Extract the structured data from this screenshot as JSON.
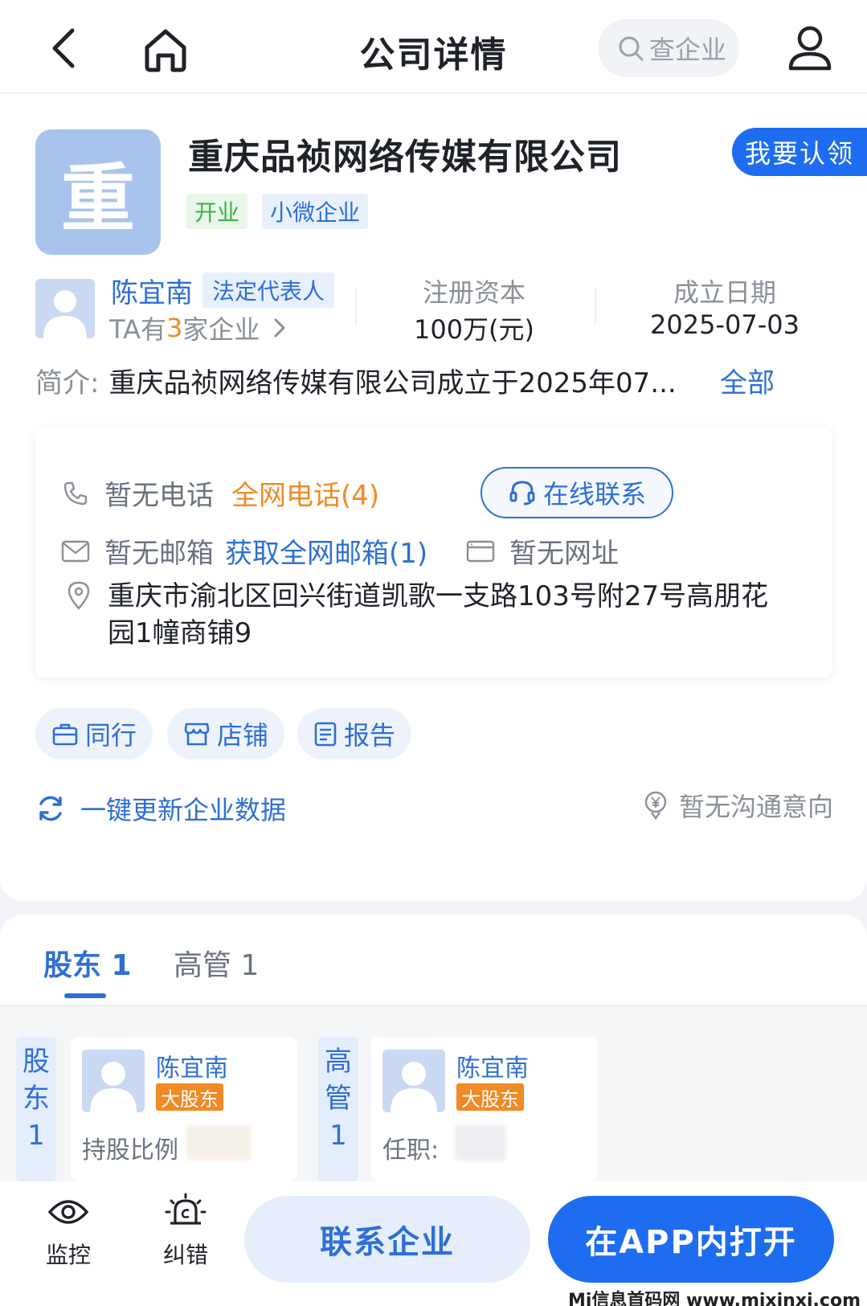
{
  "header": {
    "title": "公司详情",
    "search_label": "查企业"
  },
  "company": {
    "logo_char": "重",
    "name": "重庆品祯网络传媒有限公司",
    "claim_label": "我要认领",
    "tags": [
      "开业",
      "小微企业"
    ],
    "representative": {
      "name": "陈宜南",
      "role": "法定代表人",
      "count_prefix": "TA有",
      "count": "3",
      "count_suffix": "家企业"
    },
    "registered_capital": {
      "label": "注册资本",
      "value": "100万(元)"
    },
    "established": {
      "label": "成立日期",
      "value": "2025-07-03"
    },
    "intro": {
      "label": "简介:",
      "text": "重庆品祯网络传媒有限公司成立于2025年07...",
      "more": "全部"
    }
  },
  "contact": {
    "phone_none": "暂无电话",
    "phone_all": "全网电话(4)",
    "online": "在线联系",
    "email_none": "暂无邮箱",
    "email_get": "获取全网邮箱(1)",
    "website_none": "暂无网址",
    "address": "重庆市渝北区回兴街道凯歌一支路103号附27号高朋花园1幢商铺9"
  },
  "chips": [
    "同行",
    "店铺",
    "报告"
  ],
  "refresh_label": "一键更新企业数据",
  "intent_label": "暂无沟通意向",
  "tabs": {
    "shareholders": "股东 1",
    "executives": "高管 1"
  },
  "shareholder_section": {
    "vlabel": [
      "股",
      "东",
      "1"
    ],
    "name": "陈宜南",
    "badge": "大股东",
    "field": "持股比例"
  },
  "executive_section": {
    "vlabel": [
      "高",
      "管",
      "1"
    ],
    "name": "陈宜南",
    "badge": "大股东",
    "field": "任职:"
  },
  "bottom": {
    "monitor": "监控",
    "correct": "纠错",
    "contact": "联系企业",
    "open_app": "在APP内打开"
  },
  "watermark": "Mi信息首码网 www.mixinxi.com",
  "colors": {
    "primary": "#1e6df0",
    "link": "#2d6fd6",
    "accent_orange": "#f08a24",
    "open_green": "#3bb14a"
  }
}
